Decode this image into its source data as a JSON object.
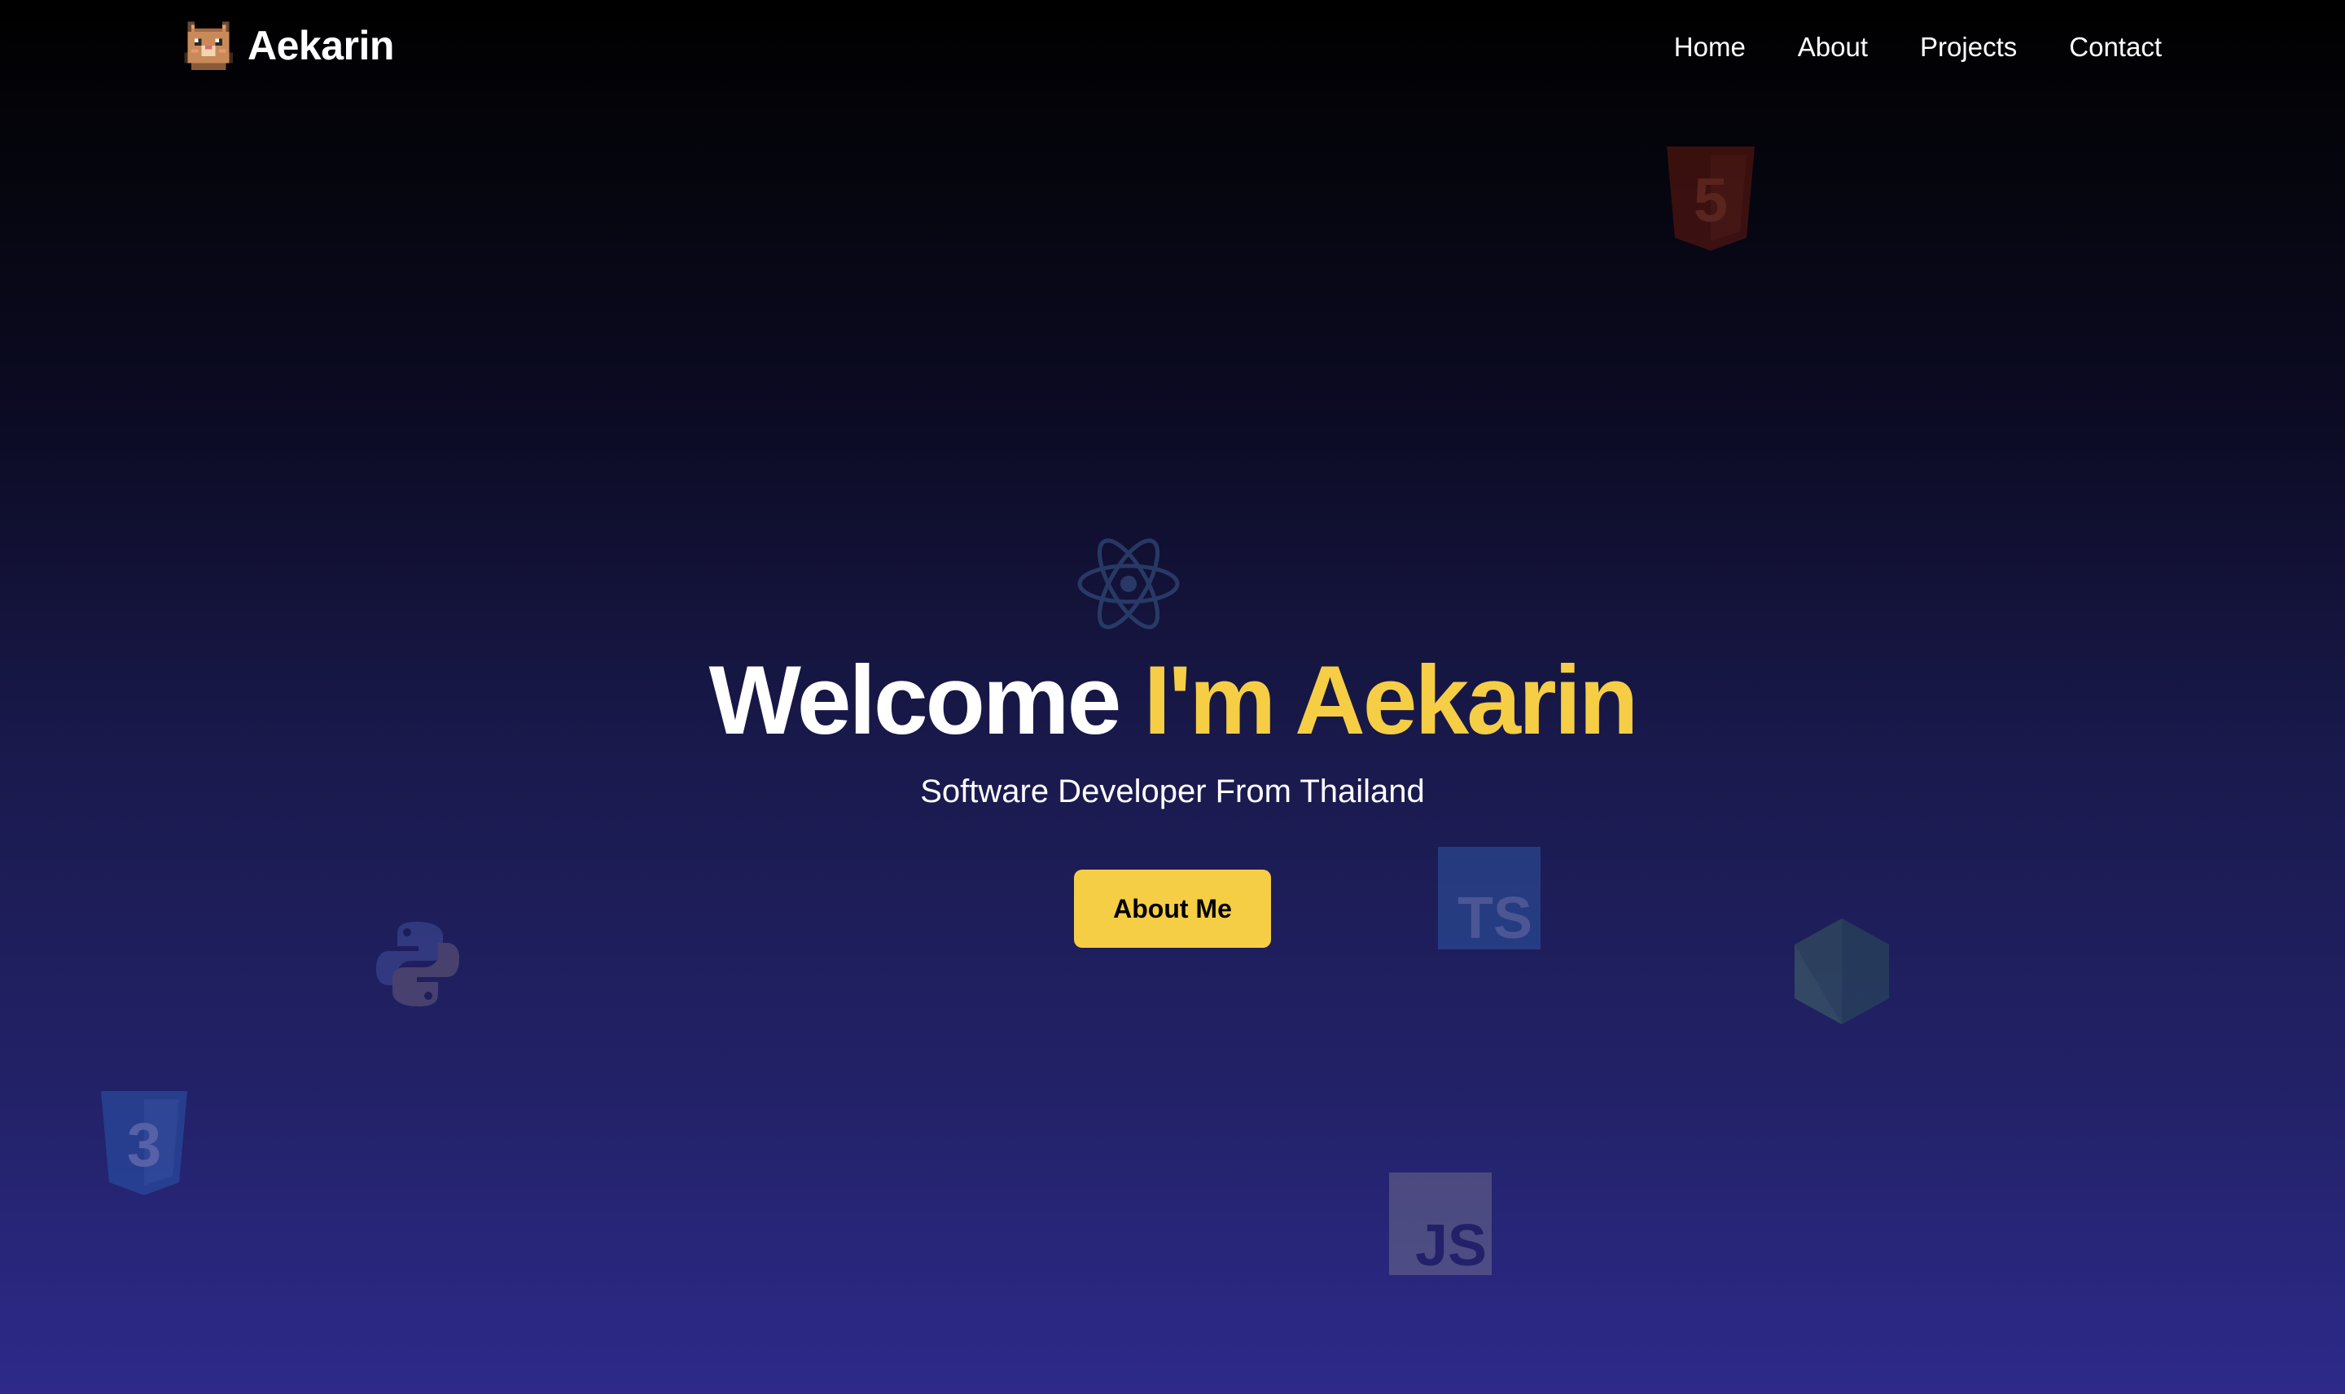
{
  "brand": {
    "name": "Aekarin",
    "logo_icon": "cat-pixel-icon"
  },
  "nav": {
    "items": [
      {
        "label": "Home"
      },
      {
        "label": "About"
      },
      {
        "label": "Projects"
      },
      {
        "label": "Contact"
      }
    ]
  },
  "hero": {
    "title_welcome": "Welcome",
    "title_name": "I'm Aekarin",
    "subtitle": "Software Developer From Thailand",
    "cta_label": "About Me"
  },
  "tech_icons": {
    "html5": {
      "name": "html5-icon",
      "label": "5"
    },
    "react": {
      "name": "react-icon"
    },
    "typescript": {
      "name": "typescript-icon",
      "label": "TS"
    },
    "python": {
      "name": "python-icon"
    },
    "nodejs": {
      "name": "nodejs-icon"
    },
    "css3": {
      "name": "css3-icon",
      "label": "3"
    },
    "javascript": {
      "name": "javascript-icon",
      "label": "JS"
    }
  },
  "colors": {
    "accent": "#f5ce45",
    "text": "#ffffff",
    "background_top": "#000000",
    "background_bottom": "#2d2a8a"
  }
}
